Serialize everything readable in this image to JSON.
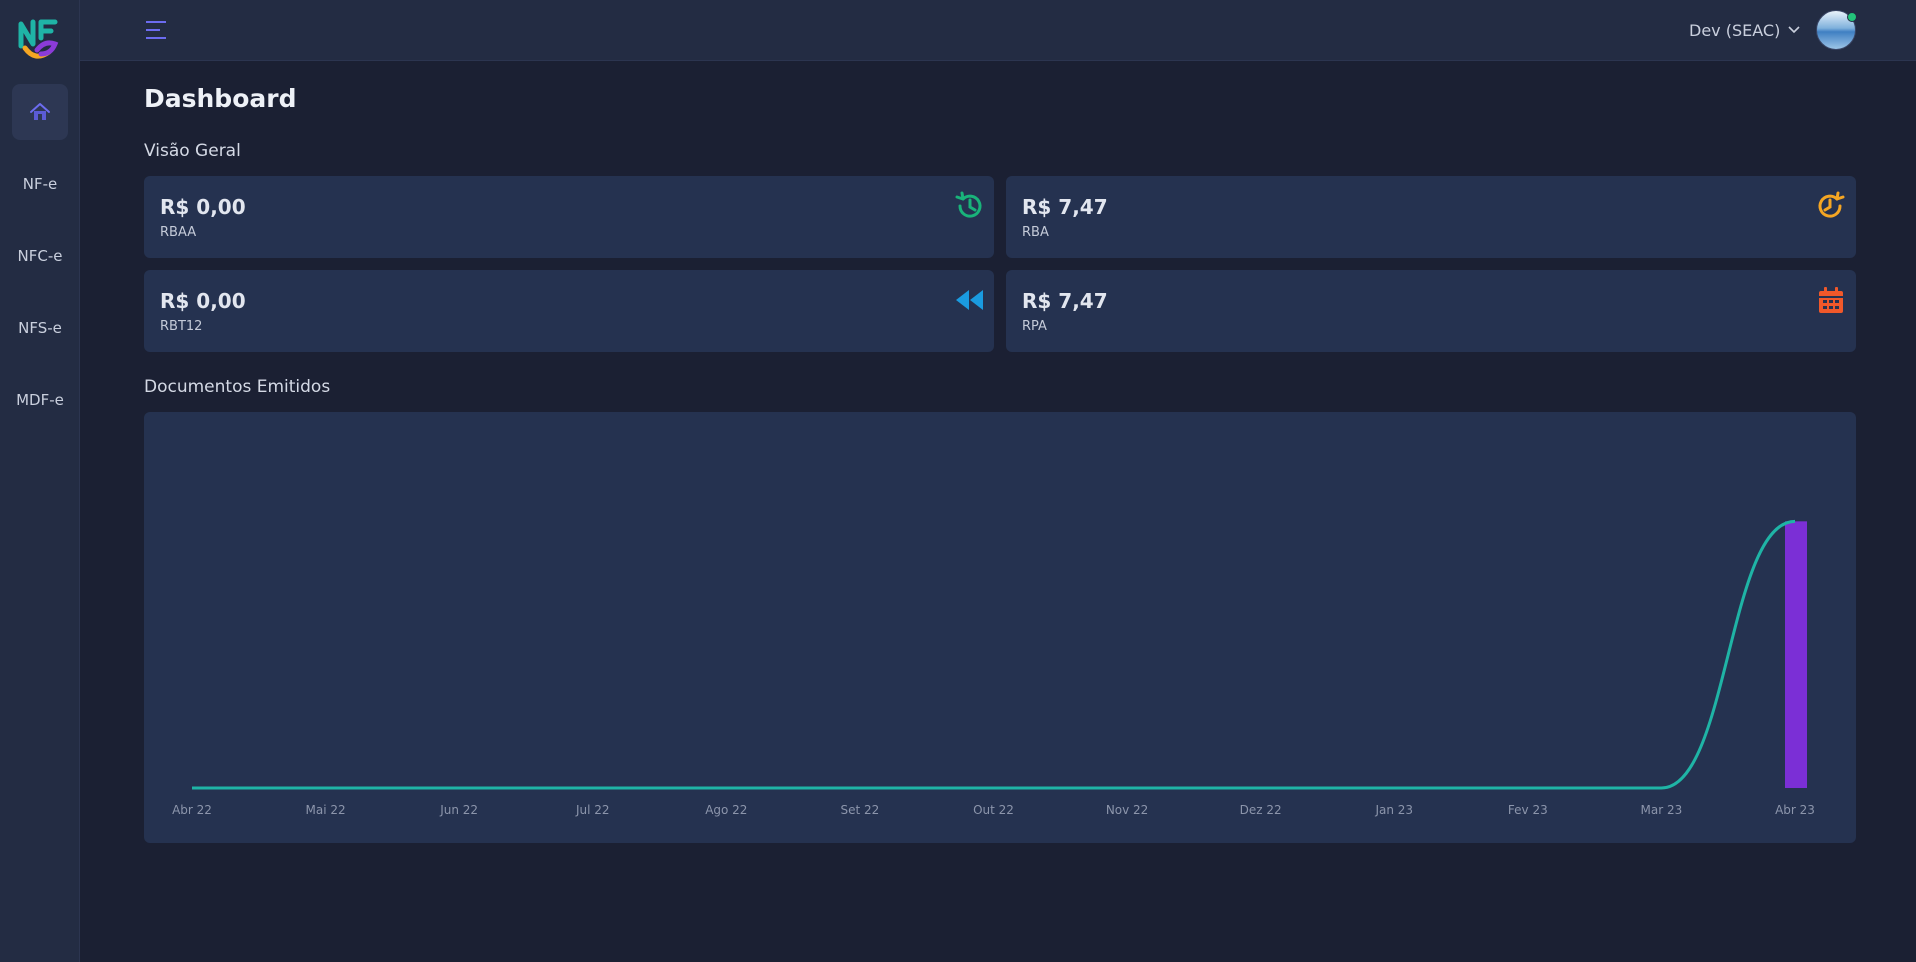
{
  "app": {
    "brand_letters": "NFe"
  },
  "sidebar": {
    "items": [
      {
        "label": "Home",
        "icon": "home-icon"
      },
      {
        "label": "NF-e"
      },
      {
        "label": "NFC-e"
      },
      {
        "label": "NFS-e"
      },
      {
        "label": "MDF-e"
      }
    ]
  },
  "header": {
    "user_label": "Dev (SEAC)"
  },
  "main": {
    "title": "Dashboard",
    "overview_title": "Visão Geral",
    "cards": [
      {
        "value": "R$ 0,00",
        "label": "RBAA",
        "icon": "history-icon",
        "color": "#19b37a"
      },
      {
        "value": "R$ 7,47",
        "label": "RBA",
        "icon": "clock-rotate-icon",
        "color": "#f5a623"
      },
      {
        "value": "R$ 0,00",
        "label": "RBT12",
        "icon": "backward-icon",
        "color": "#1a9be0"
      },
      {
        "value": "R$ 7,47",
        "label": "RPA",
        "icon": "calendar-icon",
        "color": "#f0582a"
      }
    ],
    "documents_title": "Documentos Emitidos"
  },
  "chart_data": {
    "type": "bar",
    "categories": [
      "Abr 22",
      "Mai 22",
      "Jun 22",
      "Jul 22",
      "Ago 22",
      "Set 22",
      "Out 22",
      "Nov 22",
      "Dez 22",
      "Jan 23",
      "Fev 23",
      "Mar 23",
      "Abr 23"
    ],
    "series": [
      {
        "type": "bar",
        "values": [
          0,
          0,
          0,
          0,
          0,
          0,
          0,
          0,
          0,
          0,
          0,
          0,
          1
        ],
        "color": "#7b2fd6"
      },
      {
        "type": "line",
        "values": [
          0,
          0,
          0,
          0,
          0,
          0,
          0,
          0,
          0,
          0,
          0,
          0,
          1
        ],
        "color": "#1fb4a6"
      }
    ],
    "ylim": [
      0,
      1.2
    ],
    "grid": false,
    "legend": "none"
  },
  "colors": {
    "background": "#1b2033",
    "panel": "#253250",
    "accent": "#5b5bd6"
  }
}
